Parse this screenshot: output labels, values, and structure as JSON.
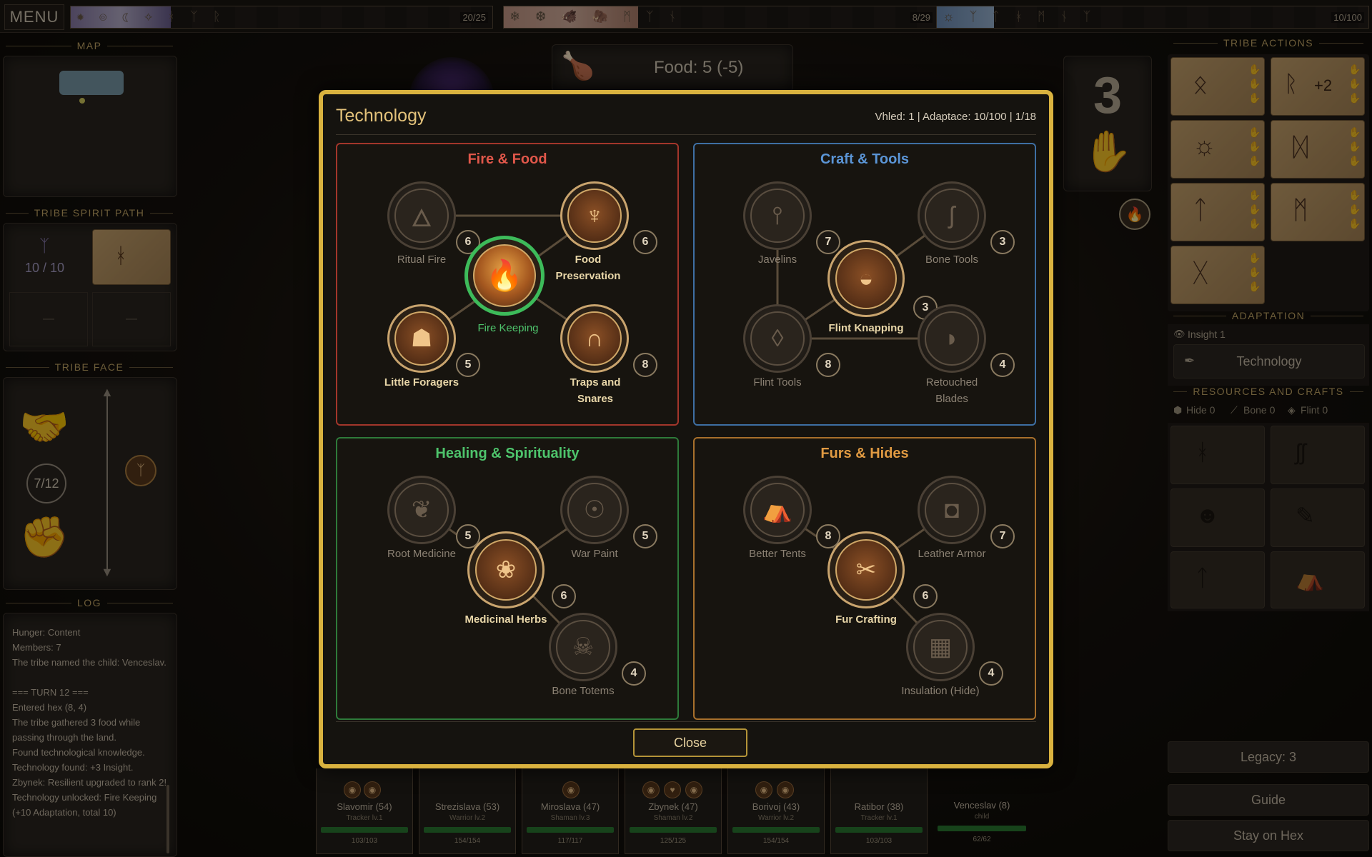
{
  "topbar": {
    "menu_label": "MENU",
    "tracks": [
      {
        "count": "20/25",
        "glyphs": "✹ ◎ ☾ ✧ ᚼ ᛉ ᚱ"
      },
      {
        "count": "8/29",
        "glyphs": "❄ ❆ 🐗 🦣 ᛗ ᛉ ᚾ"
      },
      {
        "count": "10/100",
        "glyphs": "☼ ᛉ ᛏ ᚼ ᛗ ᚾ ᛉ"
      }
    ]
  },
  "left": {
    "map_title": "MAP",
    "spirit_title": "TRIBE SPIRIT PATH",
    "spirit_count": "10 / 10",
    "spirit_empty_1": "—",
    "spirit_empty_2": "—",
    "face_title": "TRIBE FACE",
    "face_count": "7/12",
    "log_title": "LOG",
    "log_lines": [
      "Hunger: Content",
      "Members: 7",
      "The tribe named the child: Venceslav.",
      "",
      "=== TURN 12 ===",
      "Entered hex (8, 4)",
      "The tribe gathered 3 food while passing through the land.",
      "Found technological knowledge.",
      "Technology found: +3 Insight.",
      "Zbynek: Resilient upgraded to rank 2!",
      "Technology unlocked: Fire Keeping (+10 Adaptation, total 10)"
    ]
  },
  "food": {
    "label": "Food: 5  (-5)"
  },
  "turn": {
    "number": "3"
  },
  "right": {
    "actions_title": "TRIBE ACTIONS",
    "plus_badge": "+2",
    "adaptation_title": "ADAPTATION",
    "insight_label": "Insight 1",
    "technology_button": "Technology",
    "resources_title": "RESOURCES AND CRAFTS",
    "resources": [
      {
        "icon": "hide-icon",
        "label": "Hide 0"
      },
      {
        "icon": "bone-icon",
        "label": "Bone 0"
      },
      {
        "icon": "flint-icon",
        "label": "Flint 0"
      }
    ],
    "legacy_label": "Legacy: 3",
    "guide_label": "Guide",
    "stay_label": "Stay on Hex"
  },
  "modal": {
    "title": "Technology",
    "stats": "Vhled: 1  |  Adaptace: 10/100  |  1/18",
    "close_label": "Close",
    "sections": [
      {
        "title": "Fire & Food",
        "color": "#c0392b",
        "title_color": "#e0574a",
        "nodes": [
          {
            "name": "Ritual Fire",
            "cost": "6",
            "state": "locked",
            "glyph": "🜂"
          },
          {
            "name": "Food Preservation",
            "cost": "6",
            "state": "unlocked",
            "glyph": "♆"
          },
          {
            "name": "Fire Keeping",
            "cost": "",
            "state": "active",
            "glyph": "🔥"
          },
          {
            "name": "Little Foragers",
            "cost": "5",
            "state": "unlocked",
            "glyph": "☗"
          },
          {
            "name": "Traps and Snares",
            "cost": "8",
            "state": "unlocked",
            "glyph": "∩"
          }
        ]
      },
      {
        "title": "Craft & Tools",
        "color": "#3e6fa3",
        "title_color": "#5b95d6",
        "nodes": [
          {
            "name": "Javelins",
            "cost": "7",
            "state": "locked",
            "glyph": "⫯"
          },
          {
            "name": "Bone Tools",
            "cost": "3",
            "state": "locked",
            "glyph": "ʃ"
          },
          {
            "name": "Flint Knapping",
            "cost": "3",
            "state": "unlocked",
            "glyph": "◒"
          },
          {
            "name": "Flint Tools",
            "cost": "8",
            "state": "locked",
            "glyph": "◊"
          },
          {
            "name": "Retouched Blades",
            "cost": "4",
            "state": "locked",
            "glyph": "◗"
          }
        ]
      },
      {
        "title": "Healing & Spirituality",
        "color": "#2e8b3e",
        "title_color": "#4ec46c",
        "nodes": [
          {
            "name": "Root Medicine",
            "cost": "5",
            "state": "locked",
            "glyph": "❦"
          },
          {
            "name": "War Paint",
            "cost": "5",
            "state": "locked",
            "glyph": "☉"
          },
          {
            "name": "Medicinal Herbs",
            "cost": "6",
            "state": "unlocked",
            "glyph": "❀"
          },
          {
            "name": "Bone Totems",
            "cost": "4",
            "state": "locked",
            "glyph": "☠"
          }
        ]
      },
      {
        "title": "Furs & Hides",
        "color": "#b8782f",
        "title_color": "#e09a42",
        "nodes": [
          {
            "name": "Better Tents",
            "cost": "8",
            "state": "locked",
            "glyph": "⛺"
          },
          {
            "name": "Leather Armor",
            "cost": "7",
            "state": "locked",
            "glyph": "◘"
          },
          {
            "name": "Fur Crafting",
            "cost": "6",
            "state": "unlocked",
            "glyph": "✂"
          },
          {
            "name": "Insulation (Hide)",
            "cost": "4",
            "state": "locked",
            "glyph": "▦"
          }
        ]
      }
    ]
  },
  "members": [
    {
      "name": "Slavomir (54)",
      "role": "Tracker lv.1",
      "hp": "103/103",
      "icons": [
        "◉",
        "◉"
      ]
    },
    {
      "name": "Strezislava (53)",
      "role": "Warrior lv.2",
      "hp": "154/154",
      "icons": []
    },
    {
      "name": "Miroslava (47)",
      "role": "Shaman lv.3",
      "hp": "117/117",
      "icons": [
        "◉"
      ]
    },
    {
      "name": "Zbynek (47)",
      "role": "Shaman lv.2",
      "hp": "125/125",
      "icons": [
        "◉",
        "♥",
        "◉"
      ]
    },
    {
      "name": "Borivoj (43)",
      "role": "Warrior lv.2",
      "hp": "154/154",
      "icons": [
        "◉",
        "◉"
      ]
    },
    {
      "name": "Ratibor (38)",
      "role": "Tracker lv.1",
      "hp": "103/103",
      "icons": []
    },
    {
      "name": "Venceslav (8)",
      "role": "child",
      "hp": "62/62",
      "icons": []
    }
  ]
}
